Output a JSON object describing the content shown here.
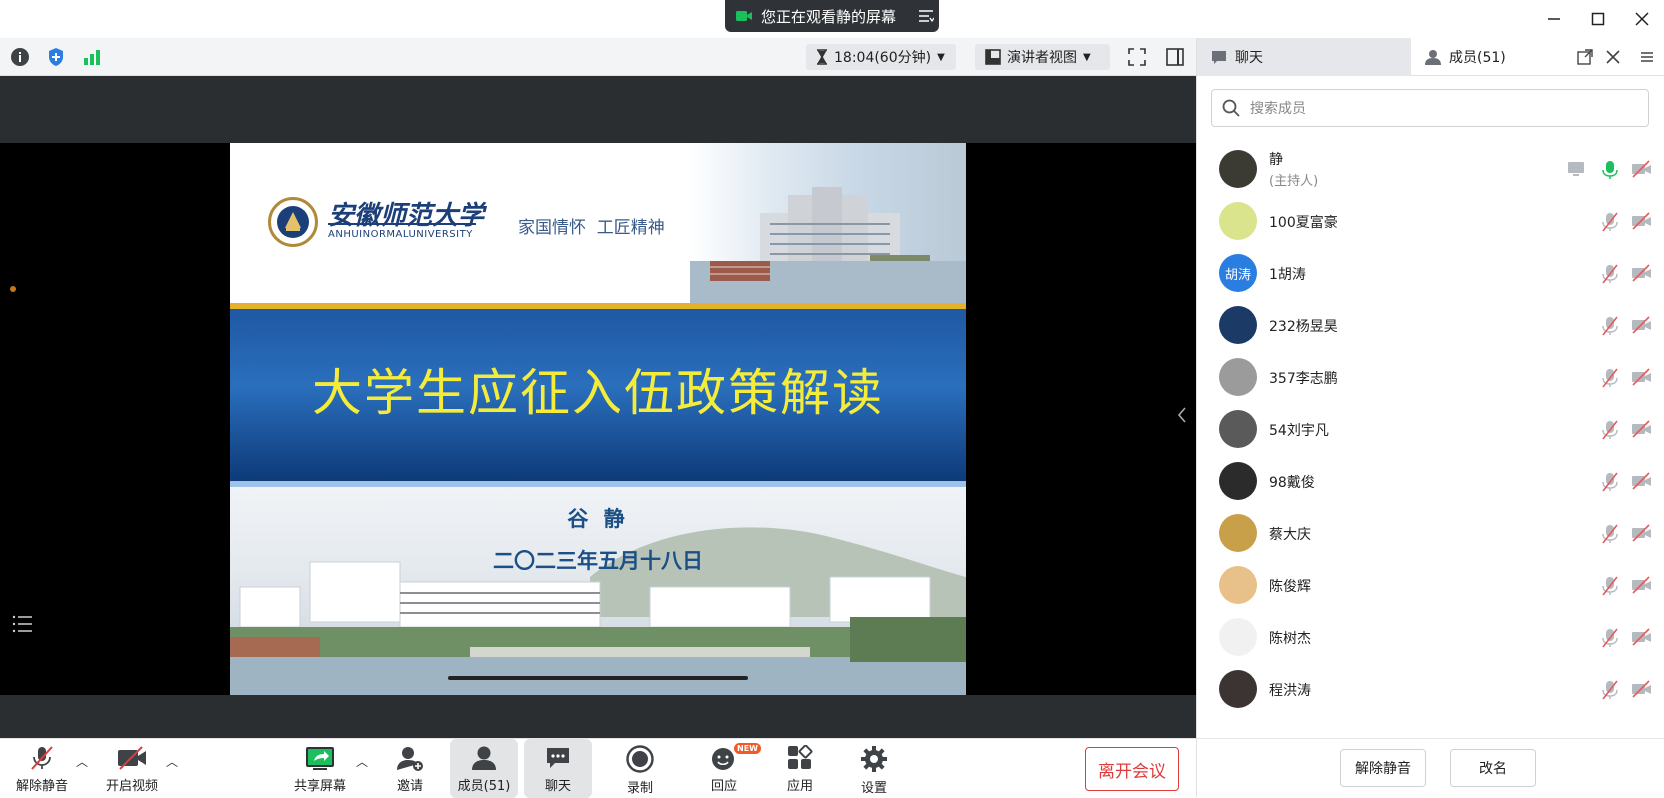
{
  "banner": {
    "text": "您正在观看静的屏幕"
  },
  "toolbar": {
    "timer": "18:04(60分钟)",
    "view_mode": "演讲者视图"
  },
  "slide": {
    "logo_cn": "安徽师范大学",
    "logo_en": "ANHUINORMALUNIVERSITY",
    "motto": "家国情怀  工匠精神",
    "title": "大学生应征入伍政策解读",
    "presenter": "谷 静",
    "date": "二〇二三年五月十八日"
  },
  "controls": {
    "unmute": "解除静音",
    "video": "开启视频",
    "share": "共享屏幕",
    "invite": "邀请",
    "members": "成员(51)",
    "chat": "聊天",
    "record": "录制",
    "react": "回应",
    "react_badge": "NEW",
    "apps": "应用",
    "settings": "设置",
    "leave": "离开会议"
  },
  "panel": {
    "tab_chat": "聊天",
    "tab_members": "成员(51)",
    "search_placeholder": "搜索成员",
    "members": [
      {
        "name": "静",
        "sub": "(主持人)",
        "avatar_color": "#3b3a33",
        "mic_on": true
      },
      {
        "name": "100夏富豪",
        "avatar_color": "#d9e48c"
      },
      {
        "name": "1胡涛",
        "avatar_text": "胡涛",
        "avatar_color": "#2a7de1"
      },
      {
        "name": "232杨昱昊",
        "avatar_color": "#1b3b66"
      },
      {
        "name": "357李志鹏",
        "avatar_color": "#9b9b9b"
      },
      {
        "name": "54刘宇凡",
        "avatar_color": "#5a5a5a"
      },
      {
        "name": "98戴俊",
        "avatar_color": "#2b2b2b"
      },
      {
        "name": "蔡大庆",
        "avatar_color": "#c9a04a"
      },
      {
        "name": "陈俊辉",
        "avatar_color": "#e8c08a"
      },
      {
        "name": "陈树杰",
        "avatar_color": "#f1f1f1"
      },
      {
        "name": "程洪涛",
        "avatar_color": "#3b3433"
      }
    ],
    "unmute_btn": "解除静音",
    "rename_btn": "改名"
  }
}
